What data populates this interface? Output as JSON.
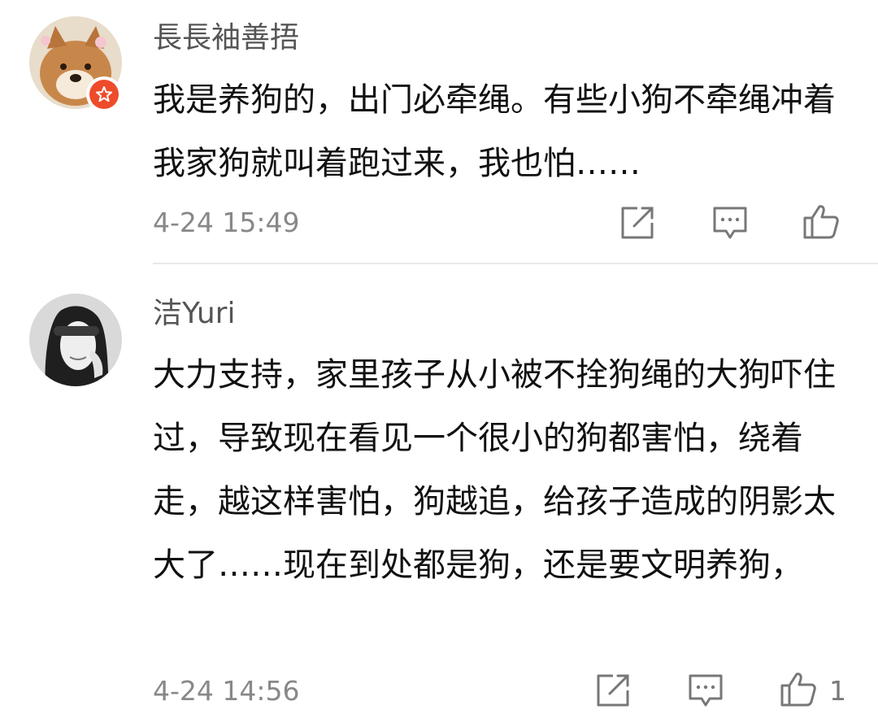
{
  "comments": [
    {
      "username": "長長袖善捂",
      "content": "我是养狗的，出门必牵绳。有些小狗不牵绳冲着我家狗就叫着跑过来，我也怕……",
      "timestamp": "4-24 15:49",
      "like_count": "",
      "avatar": "shiba-dog-avatar",
      "has_badge": true
    },
    {
      "username": "洁Yuri",
      "content": "大力支持，家里孩子从小被不拴狗绳的大狗吓住过，导致现在看见一个很小的狗都害怕，绕着走，越这样害怕，狗越追，给孩子造成的阴影太大了……现在到处都是狗，还是要文明养狗，",
      "timestamp": "4-24 14:56",
      "like_count": "1",
      "avatar": "woman-portrait-avatar",
      "has_badge": false
    }
  ],
  "icons": {
    "share": "share-icon",
    "reply": "comment-icon",
    "like": "thumbs-up-icon"
  },
  "colors": {
    "badge": "#ee4b2b",
    "meta_text": "#888888",
    "username_text": "#555555",
    "icon_stroke": "#777777",
    "divider": "#e9e9e9"
  }
}
